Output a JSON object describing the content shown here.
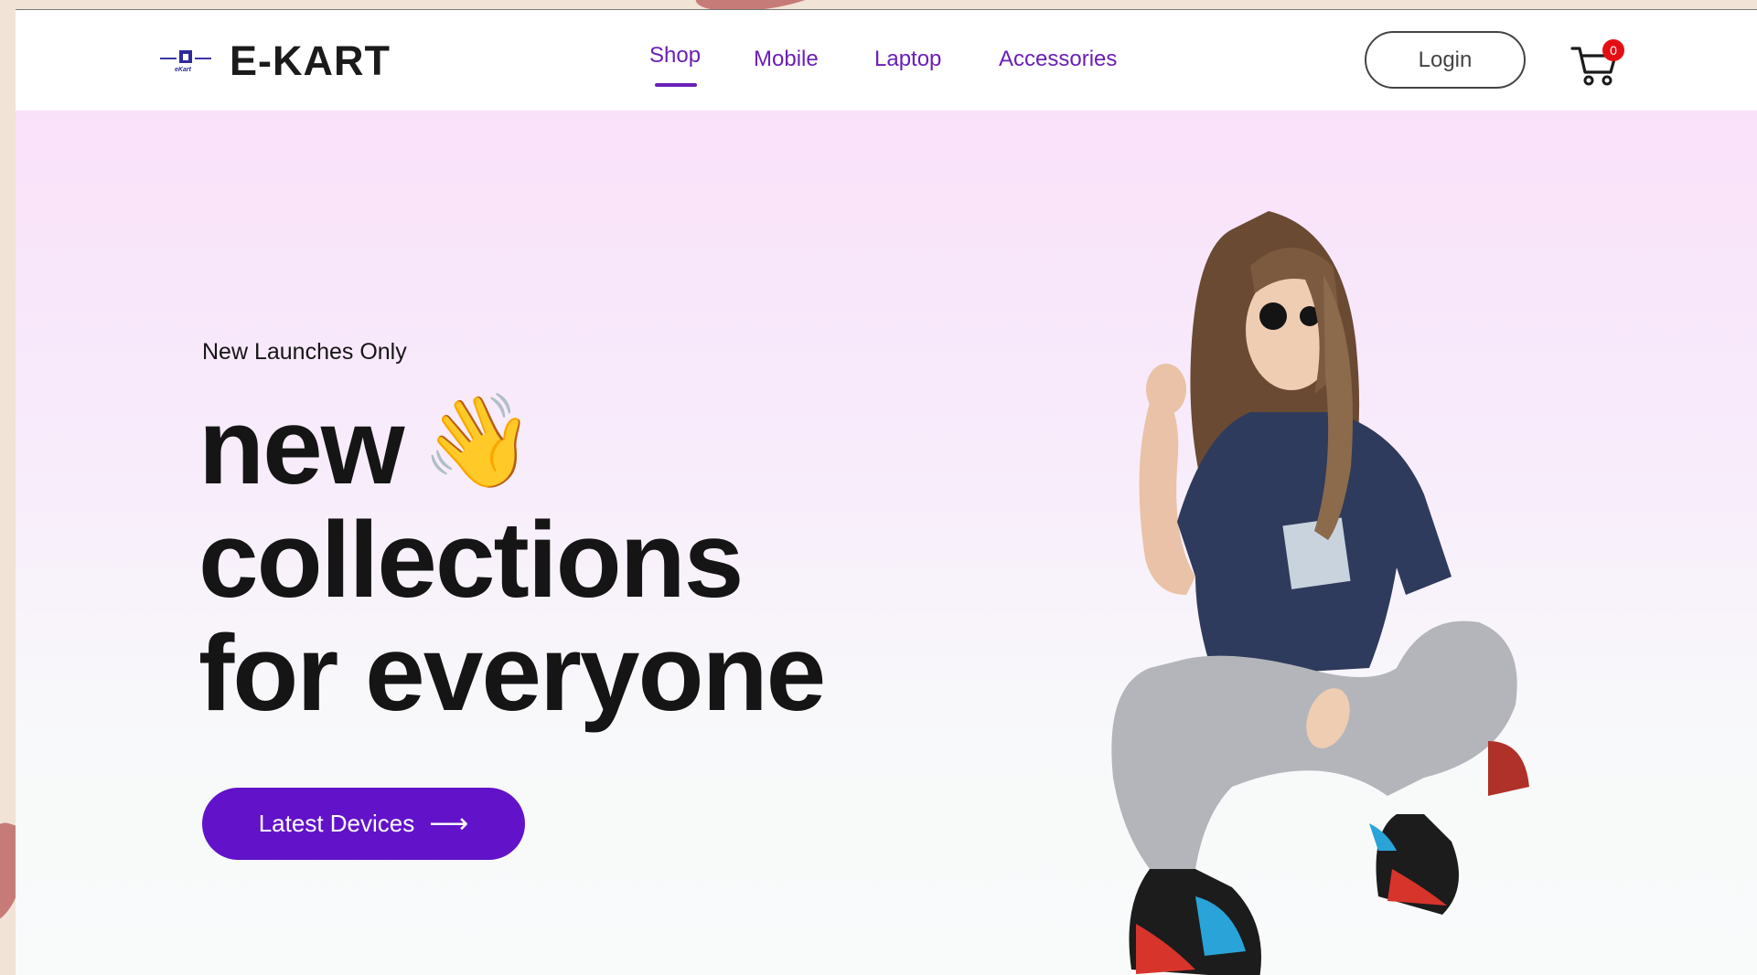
{
  "brand": {
    "logo_text": "eKart",
    "name": "E-KART"
  },
  "nav": {
    "items": [
      {
        "label": "Shop",
        "active": true
      },
      {
        "label": "Mobile"
      },
      {
        "label": "Laptop"
      },
      {
        "label": "Accessories"
      }
    ]
  },
  "header": {
    "login_label": "Login",
    "cart_count": "0"
  },
  "hero": {
    "eyebrow": "New Launches Only",
    "headline_line1": "new",
    "wave_emoji": "👋",
    "headline_line2": "collections",
    "headline_line3": "for everyone",
    "cta_label": "Latest Devices",
    "cta_arrow": "⟶"
  },
  "colors": {
    "accent": "#6213c9",
    "nav_text": "#6a1fb8",
    "badge": "#e30f14",
    "hero_top": "#f9e1fa",
    "hero_bottom": "#f9fbfb"
  }
}
